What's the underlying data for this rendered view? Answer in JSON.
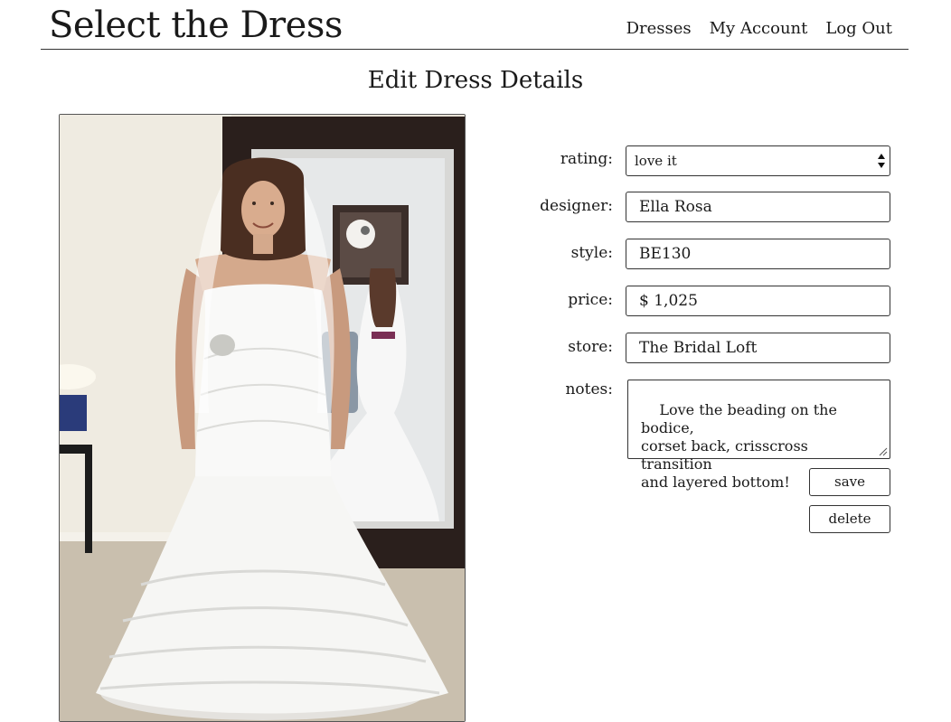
{
  "header": {
    "brand": "Select the Dress",
    "nav": {
      "dresses": "Dresses",
      "account": "My Account",
      "logout": "Log Out"
    }
  },
  "page": {
    "title": "Edit Dress Details"
  },
  "photo": {
    "alt": "bride trying on white mermaid dress with ruffled skirt and veil"
  },
  "form": {
    "rating": {
      "label": "rating:",
      "value": "love it"
    },
    "designer": {
      "label": "designer:",
      "value": "Ella Rosa"
    },
    "style": {
      "label": "style:",
      "value": "BE130"
    },
    "price": {
      "label": "price:",
      "value": "$ 1,025"
    },
    "store": {
      "label": "store:",
      "value": "The Bridal Loft"
    },
    "notes": {
      "label": "notes:",
      "value": "Love the beading on the bodice,\ncorset back, crisscross transition\nand layered bottom!"
    },
    "save_label": "save",
    "delete_label": "delete"
  },
  "icons": {
    "select_arrows": "select-arrows-icon",
    "resize": "resize-grip-icon"
  },
  "colors": {
    "text": "#1a1a1a",
    "border": "#333333",
    "background": "#ffffff"
  }
}
